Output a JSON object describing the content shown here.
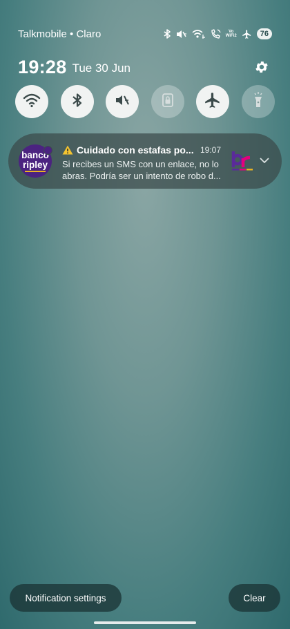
{
  "status_bar": {
    "carrier": "Talkmobile • Claro",
    "vowifi_label": "Vo WiFi2",
    "battery": "76",
    "icons": [
      "bluetooth-icon",
      "vibrate-mute-icon",
      "wifi-calling-icon",
      "call-icon",
      "vowifi-icon",
      "airplane-icon",
      "battery-icon"
    ]
  },
  "clock": {
    "time": "19:28",
    "date": "Tue 30 Jun"
  },
  "quick_settings": {
    "tiles": [
      {
        "icon": "wifi-icon",
        "state": "on"
      },
      {
        "icon": "bluetooth-icon",
        "state": "on"
      },
      {
        "icon": "sound-mute-icon",
        "state": "on"
      },
      {
        "icon": "lock-icon",
        "state": "off"
      },
      {
        "icon": "airplane-icon",
        "state": "on"
      },
      {
        "icon": "flashlight-icon",
        "state": "off"
      }
    ]
  },
  "notification": {
    "app_icon_text_1": "banco",
    "app_icon_text_2": "ripley",
    "title": "Cuidado con estafas po...",
    "time": "19:07",
    "body_line_1": "Si recibes un SMS con un enlace, no lo",
    "body_line_2": "abras. Podría ser un intento de robo d...",
    "brand_thumb_icon": "banco-ripley-br-logo",
    "colors": {
      "app_icon_bg": "#4b2380",
      "accent_yellow": "#e9b323",
      "brand_pink": "#e5007e"
    }
  },
  "buttons": {
    "notification_settings": "Notification settings",
    "clear": "Clear"
  }
}
